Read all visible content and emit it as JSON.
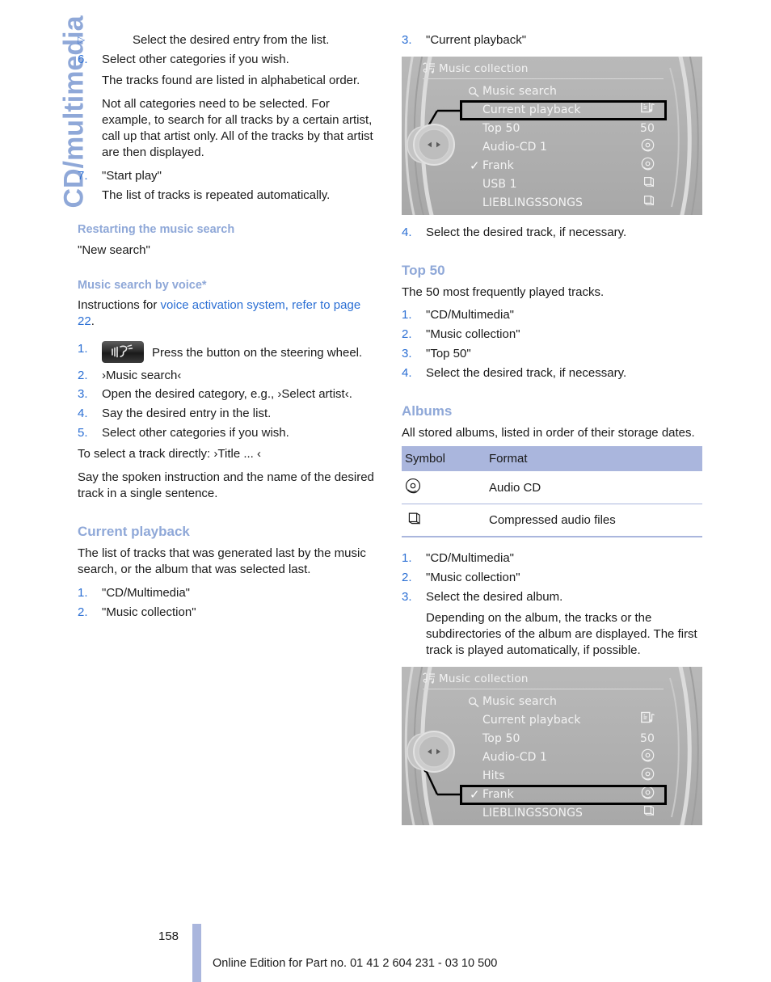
{
  "chapter_tab": "CD/multimedia",
  "colors": {
    "heading_blue": "#8fa8d8",
    "link_blue": "#2b6fd4",
    "table_header": "#aab6dd",
    "screen_grey": "#b2b2b2"
  },
  "left_column": {
    "bullet_top": {
      "marker": "▷",
      "text": "Select the desired entry from the list."
    },
    "steps_continued": [
      {
        "num": "6.",
        "text": "Select other categories if you wish."
      }
    ],
    "para_alphabetical": "The tracks found are listed in alphabetical order.",
    "para_not_all": "Not all categories need to be selected. For example, to search for all tracks by a certain artist, call up that artist only. All of the tracks by that artist are then displayed.",
    "step7": {
      "num": "7.",
      "text": "\"Start play\""
    },
    "para_repeated": "The list of tracks is repeated automatically.",
    "restart_heading": "Restarting the music search",
    "restart_text": "\"New search\"",
    "voice_heading": "Music search by voice*",
    "voice_intro_prefix": "Instructions for ",
    "voice_intro_link": "voice activation system, refer to page 22",
    "voice_intro_suffix": ".",
    "voice_steps": [
      {
        "num": "1.",
        "text": "Press the button on the steering wheel.",
        "has_button": true
      },
      {
        "num": "2.",
        "text": "›Music search‹"
      },
      {
        "num": "3.",
        "text": "Open the desired category, e.g., ›Select artist‹."
      },
      {
        "num": "4.",
        "text": "Say the desired entry in the list."
      },
      {
        "num": "5.",
        "text": "Select other categories if you wish."
      }
    ],
    "para_direct": "To select a track directly: ›Title ... ‹",
    "para_spoken": "Say the spoken instruction and the name of the desired track in a single sentence.",
    "current_playback_heading": "Current playback",
    "current_playback_text": "The list of tracks that was generated last by the music search, or the album that was selected last.",
    "current_playback_steps": [
      {
        "num": "1.",
        "text": "\"CD/Multimedia\""
      },
      {
        "num": "2.",
        "text": "\"Music collection\""
      }
    ]
  },
  "right_column": {
    "step3": {
      "num": "3.",
      "text": "\"Current playback\""
    },
    "step4": {
      "num": "4.",
      "text": "Select the desired track, if necessary."
    },
    "top50_heading": "Top 50",
    "top50_text": "The 50 most frequently played tracks.",
    "top50_steps": [
      {
        "num": "1.",
        "text": "\"CD/Multimedia\""
      },
      {
        "num": "2.",
        "text": "\"Music collection\""
      },
      {
        "num": "3.",
        "text": "\"Top 50\""
      },
      {
        "num": "4.",
        "text": "Select the desired track, if necessary."
      }
    ],
    "albums_heading": "Albums",
    "albums_text": "All stored albums, listed in order of their storage dates.",
    "table": {
      "headers": [
        "Symbol",
        "Format"
      ],
      "rows": [
        {
          "icon": "audio-cd-icon",
          "format": "Audio CD"
        },
        {
          "icon": "folder-icon",
          "format": "Compressed audio files"
        }
      ]
    },
    "albums_steps": [
      {
        "num": "1.",
        "text": "\"CD/Multimedia\""
      },
      {
        "num": "2.",
        "text": "\"Music collection\""
      },
      {
        "num": "3.",
        "text": "Select the desired album."
      }
    ],
    "albums_note": "Depending on the album, the tracks or the subdirectories of the album are displayed. The first track is played automatically, if possible."
  },
  "screen_top": {
    "title": "Music collection",
    "title_icon": "music-note-icon",
    "highlight_index": 1,
    "items": [
      {
        "label": "Music search",
        "icon": "search-icon",
        "right": ""
      },
      {
        "label": "Current playback",
        "right_icon": "playback-info-icon",
        "right": ""
      },
      {
        "label": "Top 50",
        "right": "50"
      },
      {
        "label": "Audio-CD 1",
        "right_icon": "audio-cd-icon"
      },
      {
        "label": "Frank",
        "checked": true,
        "right_icon": "audio-cd-icon"
      },
      {
        "label": "USB 1",
        "right_icon": "folder-icon"
      },
      {
        "label": "LIEBLINGSSONGS",
        "right_icon": "folder-icon"
      }
    ]
  },
  "screen_bottom": {
    "title": "Music collection",
    "title_icon": "music-note-icon",
    "highlight_index": 5,
    "items": [
      {
        "label": "Music search",
        "icon": "search-icon",
        "right": ""
      },
      {
        "label": "Current playback",
        "right_icon": "playback-info-icon"
      },
      {
        "label": "Top 50",
        "right": "50"
      },
      {
        "label": "Audio-CD 1",
        "right_icon": "audio-cd-icon"
      },
      {
        "label": "Hits",
        "right_icon": "audio-cd-icon"
      },
      {
        "label": "Frank",
        "checked": true,
        "right_icon": "audio-cd-icon"
      },
      {
        "label": "LIEBLINGSSONGS",
        "right_icon": "folder-icon"
      }
    ]
  },
  "footer": {
    "page_number": "158",
    "edition_line": "Online Edition for Part no. 01 41 2 604 231 - 03 10 500"
  }
}
